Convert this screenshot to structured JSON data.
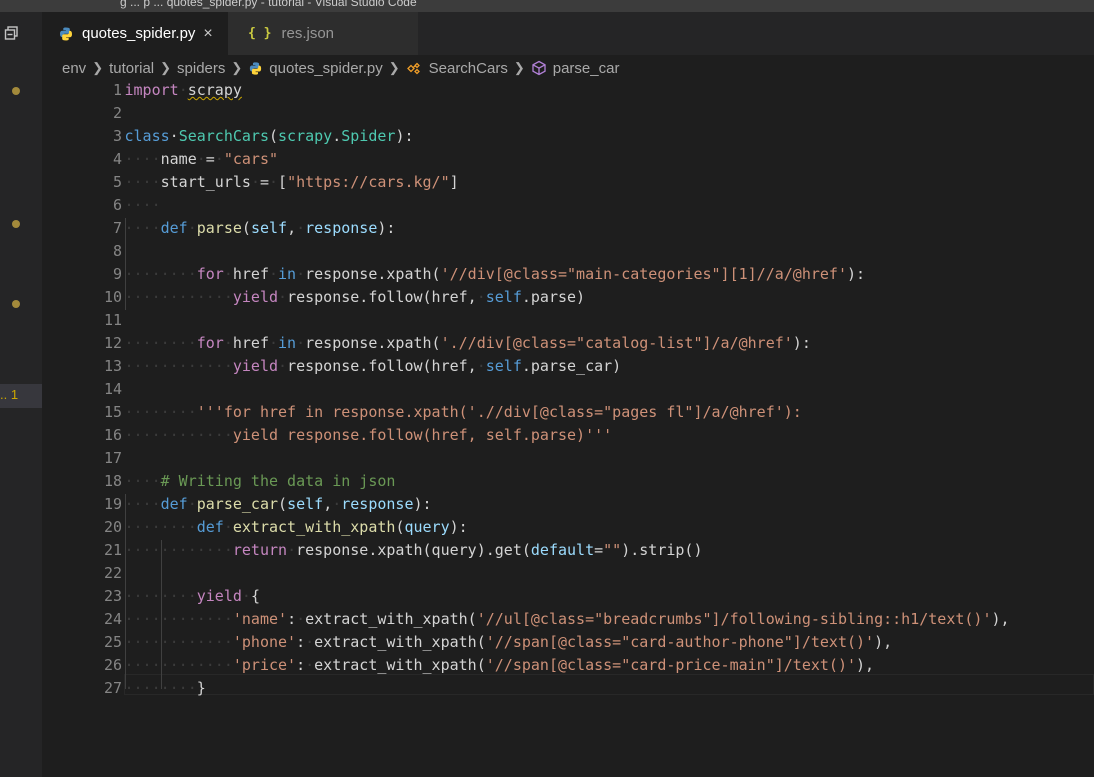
{
  "titlebar": {
    "text": "g      ...      p      ...      quotes_spider.py - tutorial - Visual Studio Code"
  },
  "activity": {
    "problem_badge": ".. 1"
  },
  "tabs": [
    {
      "label": "quotes_spider.py",
      "close": "×",
      "active": true
    },
    {
      "label": "res.json",
      "icon": "{ }",
      "active": false
    }
  ],
  "breadcrumbs": [
    "env",
    "tutorial",
    "spiders",
    "quotes_spider.py",
    "SearchCars",
    "parse_car"
  ],
  "colors": {
    "background": "#1e1e1e",
    "keyword": "#569cd6",
    "control": "#c586c0",
    "string": "#ce9178",
    "class": "#4ec9b0",
    "function": "#dcdcaa",
    "comment": "#6a9955"
  },
  "code": {
    "lines": [
      {
        "n": "1",
        "tokens": [
          [
            "kw",
            "import"
          ],
          [
            "ws",
            "·"
          ],
          [
            "sq",
            "scrapy"
          ]
        ]
      },
      {
        "n": "2",
        "tokens": []
      },
      {
        "n": "3",
        "tokens": [
          [
            "kb",
            "class"
          ],
          [
            "",
            "·"
          ],
          [
            "cls",
            "SearchCars"
          ],
          [
            "",
            "("
          ],
          [
            "cls",
            "scrapy"
          ],
          [
            "",
            "."
          ],
          [
            "cls",
            "Spider"
          ],
          [
            "",
            "):"
          ]
        ]
      },
      {
        "n": "4",
        "tokens": [
          [
            "ws",
            "····"
          ],
          [
            "",
            "name"
          ],
          [
            "ws",
            "·"
          ],
          [
            "",
            "="
          ],
          [
            "ws",
            "·"
          ],
          [
            "str",
            "\"cars\""
          ]
        ]
      },
      {
        "n": "5",
        "tokens": [
          [
            "ws",
            "····"
          ],
          [
            "",
            "start_urls"
          ],
          [
            "ws",
            "·"
          ],
          [
            "",
            "="
          ],
          [
            "ws",
            "·"
          ],
          [
            "",
            "["
          ],
          [
            "str",
            "\""
          ],
          [
            "str",
            "https://cars.kg/"
          ],
          [
            "str",
            "\""
          ],
          [
            "",
            "]"
          ]
        ]
      },
      {
        "n": "6",
        "tokens": [
          [
            "ws",
            "····"
          ]
        ]
      },
      {
        "n": "7",
        "tokens": [
          [
            "ws",
            "····"
          ],
          [
            "kb",
            "def"
          ],
          [
            "ws",
            "·"
          ],
          [
            "fn",
            "parse"
          ],
          [
            "",
            "("
          ],
          [
            "prm",
            "self"
          ],
          [
            "",
            ","
          ],
          [
            "ws",
            "·"
          ],
          [
            "prm",
            "response"
          ],
          [
            "",
            "):"
          ]
        ]
      },
      {
        "n": "8",
        "tokens": []
      },
      {
        "n": "9",
        "tokens": [
          [
            "ws",
            "········"
          ],
          [
            "kw",
            "for"
          ],
          [
            "ws",
            "·"
          ],
          [
            "",
            "href"
          ],
          [
            "ws",
            "·"
          ],
          [
            "kb",
            "in"
          ],
          [
            "ws",
            "·"
          ],
          [
            "",
            "response.xpath("
          ],
          [
            "str",
            "'//div[@class=\"main-categories\"][1]//a/@href'"
          ],
          [
            "",
            "):"
          ]
        ]
      },
      {
        "n": "10",
        "tokens": [
          [
            "ws",
            "············"
          ],
          [
            "kw",
            "yield"
          ],
          [
            "ws",
            "·"
          ],
          [
            "",
            "response.follow(href,"
          ],
          [
            "ws",
            "·"
          ],
          [
            "kb",
            "self"
          ],
          [
            "",
            ".parse)"
          ]
        ]
      },
      {
        "n": "11",
        "tokens": []
      },
      {
        "n": "12",
        "tokens": [
          [
            "ws",
            "········"
          ],
          [
            "kw",
            "for"
          ],
          [
            "ws",
            "·"
          ],
          [
            "",
            "href"
          ],
          [
            "ws",
            "·"
          ],
          [
            "kb",
            "in"
          ],
          [
            "ws",
            "·"
          ],
          [
            "",
            "response.xpath("
          ],
          [
            "str",
            "'.//div[@class=\"catalog-list\"]/a/@href'"
          ],
          [
            "",
            "):"
          ]
        ]
      },
      {
        "n": "13",
        "tokens": [
          [
            "ws",
            "············"
          ],
          [
            "kw",
            "yield"
          ],
          [
            "ws",
            "·"
          ],
          [
            "",
            "response.follow(href,"
          ],
          [
            "ws",
            "·"
          ],
          [
            "kb",
            "self"
          ],
          [
            "",
            ".parse_car)"
          ]
        ]
      },
      {
        "n": "14",
        "tokens": []
      },
      {
        "n": "15",
        "tokens": [
          [
            "ws",
            "········"
          ],
          [
            "str",
            "'''for href in response.xpath('.//div[@class=\"pages fl\"]/a/@href'):"
          ]
        ]
      },
      {
        "n": "16",
        "tokens": [
          [
            "ws",
            "············"
          ],
          [
            "str",
            "yield response.follow(href, self.parse)'''"
          ]
        ]
      },
      {
        "n": "17",
        "tokens": []
      },
      {
        "n": "18",
        "tokens": [
          [
            "ws",
            "····"
          ],
          [
            "cm",
            "# Writing the data in json"
          ]
        ]
      },
      {
        "n": "19",
        "tokens": [
          [
            "ws",
            "····"
          ],
          [
            "kb",
            "def"
          ],
          [
            "ws",
            "·"
          ],
          [
            "fn",
            "parse_car"
          ],
          [
            "",
            "("
          ],
          [
            "prm",
            "self"
          ],
          [
            "",
            ","
          ],
          [
            "ws",
            "·"
          ],
          [
            "prm",
            "response"
          ],
          [
            "",
            "):"
          ]
        ]
      },
      {
        "n": "20",
        "tokens": [
          [
            "ws",
            "········"
          ],
          [
            "kb",
            "def"
          ],
          [
            "ws",
            "·"
          ],
          [
            "fn",
            "extract_with_xpath"
          ],
          [
            "",
            "("
          ],
          [
            "prm",
            "query"
          ],
          [
            "",
            "):"
          ]
        ]
      },
      {
        "n": "21",
        "tokens": [
          [
            "ws",
            "············"
          ],
          [
            "kw",
            "return"
          ],
          [
            "ws",
            "·"
          ],
          [
            "",
            "response.xpath(query).get("
          ],
          [
            "prm",
            "default"
          ],
          [
            "",
            "="
          ],
          [
            "str",
            "\"\""
          ],
          [
            "",
            ").strip()"
          ]
        ]
      },
      {
        "n": "22",
        "tokens": []
      },
      {
        "n": "23",
        "tokens": [
          [
            "ws",
            "········"
          ],
          [
            "kw",
            "yield"
          ],
          [
            "ws",
            "·"
          ],
          [
            "",
            "{"
          ]
        ]
      },
      {
        "n": "24",
        "tokens": [
          [
            "ws",
            "············"
          ],
          [
            "str",
            "'name'"
          ],
          [
            "",
            ":"
          ],
          [
            "ws",
            "·"
          ],
          [
            "",
            "extract_with_xpath("
          ],
          [
            "str",
            "'//ul[@class=\"breadcrumbs\"]/following-sibling::h1/text()'"
          ],
          [
            "",
            "),"
          ]
        ]
      },
      {
        "n": "25",
        "tokens": [
          [
            "ws",
            "············"
          ],
          [
            "str",
            "'phone'"
          ],
          [
            "",
            ":"
          ],
          [
            "ws",
            "·"
          ],
          [
            "",
            "extract_with_xpath("
          ],
          [
            "str",
            "'//span[@class=\"card-author-phone\"]/text()'"
          ],
          [
            "",
            "),"
          ]
        ]
      },
      {
        "n": "26",
        "tokens": [
          [
            "ws",
            "············"
          ],
          [
            "str",
            "'price'"
          ],
          [
            "",
            ":"
          ],
          [
            "ws",
            "·"
          ],
          [
            "",
            "extract_with_xpath("
          ],
          [
            "str",
            "'//span[@class=\"card-price-main\"]/text()'"
          ],
          [
            "",
            "),"
          ]
        ]
      },
      {
        "n": "27",
        "tokens": [
          [
            "ws",
            "········"
          ],
          [
            "",
            "}"
          ]
        ]
      }
    ]
  }
}
